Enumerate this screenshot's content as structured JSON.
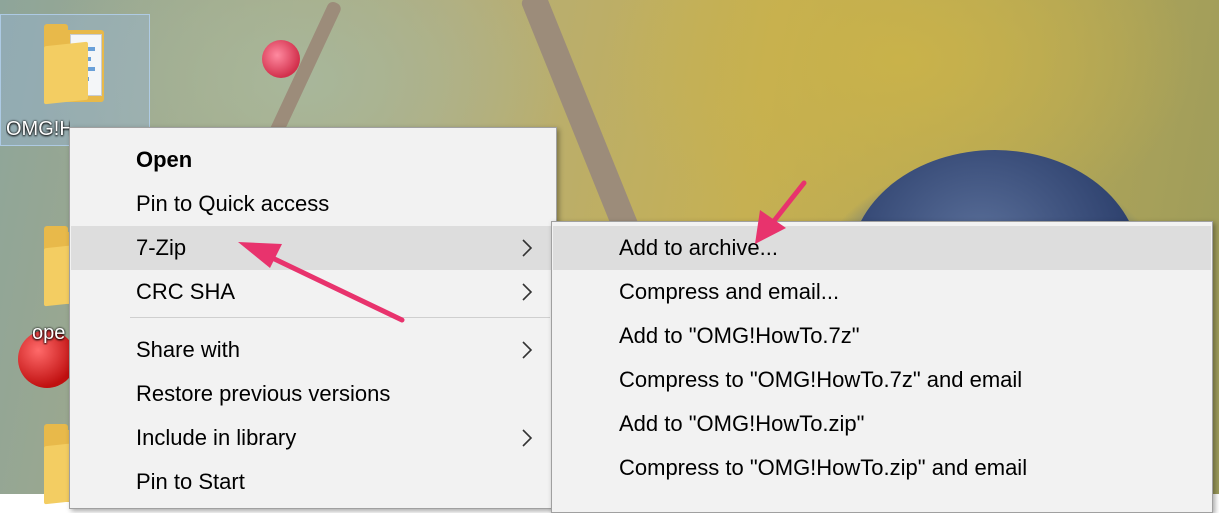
{
  "desktop": {
    "icons": [
      {
        "label": "OMG!HowTo",
        "selected": true
      },
      {
        "label": "ope"
      }
    ]
  },
  "context_menu": {
    "items": [
      {
        "label": "Open",
        "bold": true
      },
      {
        "label": "Pin to Quick access"
      },
      {
        "label": "7-Zip",
        "submenu": true,
        "highlighted": true
      },
      {
        "label": "CRC SHA",
        "submenu": true
      },
      {
        "label": "Share with",
        "submenu": true
      },
      {
        "label": "Restore previous versions"
      },
      {
        "label": "Include in library",
        "submenu": true
      },
      {
        "label": "Pin to Start"
      }
    ]
  },
  "submenu_7zip": {
    "items": [
      {
        "label": "Add to archive...",
        "highlighted": true
      },
      {
        "label": "Compress and email..."
      },
      {
        "label": "Add to \"OMG!HowTo.7z\""
      },
      {
        "label": "Compress to \"OMG!HowTo.7z\" and email"
      },
      {
        "label": "Add to \"OMG!HowTo.zip\""
      },
      {
        "label": "Compress to \"OMG!HowTo.zip\" and email"
      }
    ]
  },
  "annotations": {
    "arrow_color": "#e8336d"
  }
}
